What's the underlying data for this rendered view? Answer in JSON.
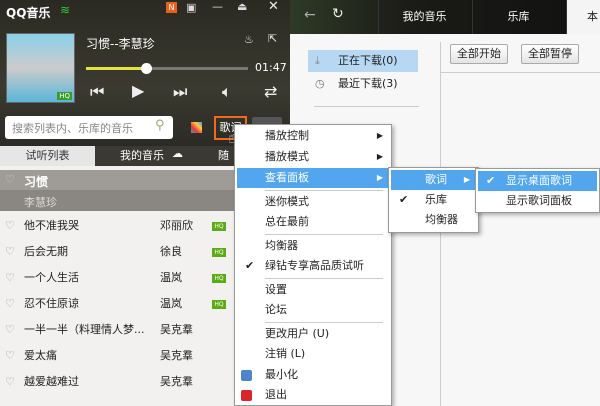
{
  "app": {
    "title": "QQ音乐",
    "badge": "N"
  },
  "player": {
    "song": "习惯--李慧珍",
    "time": "01:47",
    "progress": 0.37,
    "album_badge": "HQ"
  },
  "search": {
    "placeholder": "搜索列表内、乐库的音乐",
    "lyrics_button": "歌词"
  },
  "left_tabs": [
    "试听列表",
    "我的音乐",
    "随"
  ],
  "current": {
    "title": "习惯",
    "artist": "李慧珍"
  },
  "playlist": [
    {
      "title": "他不准我哭",
      "artist": "邓丽欣",
      "hq": "HQ"
    },
    {
      "title": "后会无期",
      "artist": "徐良",
      "hq": "HQ"
    },
    {
      "title": "一个人生活",
      "artist": "温岚",
      "hq": "HQ"
    },
    {
      "title": "忍不住原谅",
      "artist": "温岚",
      "hq": "HQ"
    },
    {
      "title": "一半一半（料理情人梦...",
      "artist": "吴克羣"
    },
    {
      "title": "爱太痛",
      "artist": "吴克羣"
    },
    {
      "title": "越爱越难过",
      "artist": "吴克羣"
    }
  ],
  "right": {
    "tabs": [
      "我的音乐",
      "乐库",
      "本"
    ],
    "nav": [
      "正在下载(0)",
      "最近下载(3)"
    ],
    "buttons": [
      "全部开始",
      "全部暂停"
    ]
  },
  "menu": {
    "items": [
      "播放控制",
      "播放模式",
      "查看面板",
      "迷你模式",
      "总在最前",
      "均衡器",
      "绿钻专享高品质试听",
      "设置",
      "论坛",
      "更改用户 (U)",
      "注销 (L)",
      "最小化",
      "退出"
    ]
  },
  "submenu": {
    "items": [
      "歌词",
      "乐库",
      "均衡器"
    ]
  },
  "submenu2": {
    "items": [
      "显示桌面歌词",
      "显示歌词面板"
    ]
  },
  "colors": {
    "highlight": "#52a6ee",
    "hq": "#5aab14",
    "accent": "#ff6a1a"
  }
}
